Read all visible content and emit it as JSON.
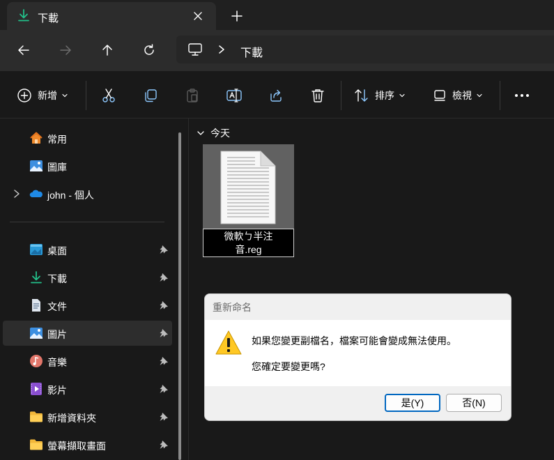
{
  "tab": {
    "title": "下載",
    "icon": "download-icon"
  },
  "address": {
    "root_icon": "this-pc-icon",
    "crumb": "下載"
  },
  "commandbar": {
    "new_label": "新增",
    "sort_label": "排序",
    "view_label": "檢視",
    "more_icon": "more-icon"
  },
  "sidebar": {
    "top": [
      {
        "label": "常用",
        "icon": "home-icon"
      },
      {
        "label": "圖庫",
        "icon": "gallery-icon"
      },
      {
        "label": "john - 個人",
        "icon": "onedrive-icon"
      }
    ],
    "pinned": [
      {
        "label": "桌面",
        "icon": "desktop-icon"
      },
      {
        "label": "下載",
        "icon": "download-icon"
      },
      {
        "label": "文件",
        "icon": "documents-icon"
      },
      {
        "label": "圖片",
        "icon": "pictures-icon",
        "selected": true
      },
      {
        "label": "音樂",
        "icon": "music-icon"
      },
      {
        "label": "影片",
        "icon": "videos-icon"
      },
      {
        "label": "新增資料夾",
        "icon": "folder-icon"
      },
      {
        "label": "螢幕擷取畫面",
        "icon": "folder-icon"
      }
    ]
  },
  "content": {
    "group_label": "今天",
    "file": {
      "name_line1": "微軟ㄅ半注",
      "name_line2": "音.reg"
    }
  },
  "dialog": {
    "title": "重新命名",
    "message": "如果您變更副檔名，檔案可能會變成無法使用。",
    "question": "您確定要變更嗎?",
    "yes_label": "是(Y)",
    "no_label": "否(N)"
  },
  "colors": {
    "accent": "#0067c0",
    "selected_bg": "#2d2d2d",
    "file_selected_bg": "#616161"
  }
}
